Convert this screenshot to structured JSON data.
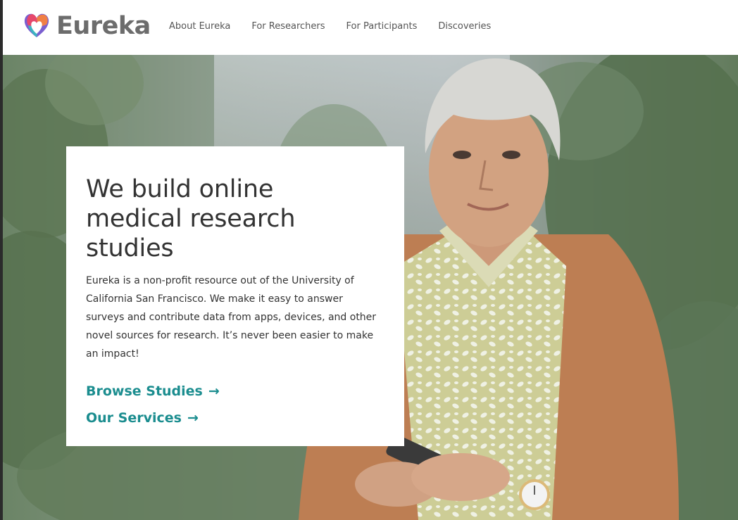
{
  "brand": {
    "name": "Eureka",
    "logo_icon": "heart-logo-icon"
  },
  "nav": {
    "items": [
      {
        "label": "About Eureka"
      },
      {
        "label": "For Researchers"
      },
      {
        "label": "For Participants"
      },
      {
        "label": "Discoveries"
      }
    ]
  },
  "hero": {
    "title": "We build online medical research studies",
    "description": "Eureka is a non-profit resource out of the University of California San Francisco. We make it easy to answer surveys and contribute data from apps, devices, and other novel sources for research. It’s never been easier to make an impact!",
    "links": [
      {
        "label": "Browse Studies",
        "arrow": "→"
      },
      {
        "label": "Our Services",
        "arrow": "→"
      }
    ]
  },
  "colors": {
    "accent": "#1b8d8f",
    "text": "#333333",
    "nav_text": "#555555",
    "brand_text": "#6c6c6c"
  }
}
